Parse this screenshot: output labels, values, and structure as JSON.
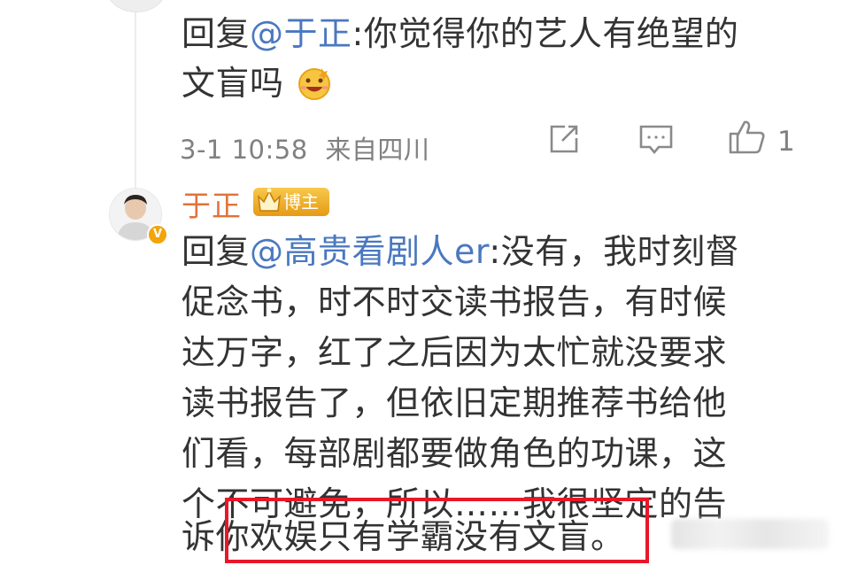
{
  "reply1": {
    "prefix": "回复",
    "mention": "@于正",
    "text_line1": ":你觉得你的艺人有绝望的",
    "text_line2": "文盲吗",
    "emoji": "grinning-face-emoji",
    "timestamp": "3-1 10:58",
    "location": "来自四川",
    "like_count": "1"
  },
  "reply2": {
    "author": "于正",
    "badge": "博主",
    "prefix": "回复",
    "mention": "@高贵看剧人er",
    "lines": [
      ":没有，我时刻督",
      "促念书，时不时交读书报告，有时候",
      "达万字，红了之后因为太忙就没要求",
      "读书报告了，但依旧定期推荐书给他",
      "们看，每部剧都要做角色的功课，这",
      "个不可避免，所以……我很坚定的告",
      "诉你欢娱只有学霸没有文盲。"
    ]
  },
  "icons": {
    "share": "share-icon",
    "comment": "comment-icon",
    "like": "thumbs-up-icon",
    "verified": "verified-v-icon"
  },
  "colors": {
    "mention": "#4a78c0",
    "author_name": "#e0733a",
    "highlight_box": "#e8172a",
    "meta_text": "#808080"
  }
}
